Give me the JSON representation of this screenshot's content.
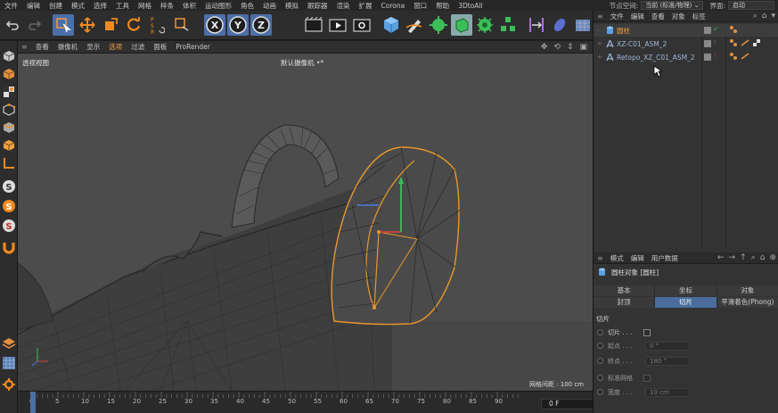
{
  "menubar": {
    "items": [
      "文件",
      "编辑",
      "创建",
      "模式",
      "选择",
      "工具",
      "网格",
      "样条",
      "体积",
      "运动图形",
      "角色",
      "动画",
      "模拟",
      "跟踪器",
      "渲染",
      "扩展",
      "Corona",
      "窗口",
      "帮助",
      "3DtoAll"
    ],
    "node_space_label": "节点空间:",
    "node_space_value": "当前 (标准/物理)",
    "layout_label": "界面:",
    "layout_value": "启动"
  },
  "toolbar": {
    "icons": [
      "undo-icon",
      "redo-icon",
      "live-select-icon",
      "move-icon",
      "scale-icon",
      "rotate-icon",
      "psr-icon",
      "select-recent-icon",
      "x-axis-icon",
      "y-axis-icon",
      "z-axis-icon",
      "render-view-icon",
      "render-picture-icon",
      "render-settings-icon",
      "cube-icon",
      "pen-icon",
      "subdivision-icon",
      "extrude-icon",
      "cloner-icon",
      "mograph-icon",
      "symmetry-icon",
      "deformer-icon",
      "floor-icon"
    ],
    "axis_labels": [
      "X",
      "Y",
      "Z"
    ]
  },
  "viewport": {
    "menu": [
      "查看",
      "摄像机",
      "显示",
      "选项",
      "过滤",
      "面板",
      "ProRender"
    ],
    "label": "透视视图",
    "camera": "默认摄像机",
    "camera_suffix": "•*",
    "grid_spacing": "网格间距 : 100 cm"
  },
  "timeline": {
    "ticks": [
      "0",
      "5",
      "10",
      "15",
      "20",
      "25",
      "30",
      "35",
      "40",
      "45",
      "50",
      "55",
      "60",
      "65",
      "70",
      "75",
      "80",
      "85",
      "90"
    ],
    "current_frame": "0 F"
  },
  "object_manager": {
    "menu": [
      "文件",
      "编辑",
      "查看",
      "对象",
      "标签"
    ],
    "objects": [
      {
        "name": "圆柱",
        "color": "#e8a030",
        "selected": true
      },
      {
        "name": "XZ-C01_ASM_2",
        "color": "#9fb6d6",
        "selected": false
      },
      {
        "name": "Retopo_XZ_C01_ASM_2",
        "color": "#9fb6d6",
        "selected": false
      }
    ]
  },
  "attributes": {
    "menu": [
      "模式",
      "编辑",
      "用户数据"
    ],
    "title": "圆柱对象 [圆柱]",
    "tabs_row1": [
      "基本",
      "坐标",
      "对象"
    ],
    "tabs_row2": [
      "封顶",
      "切片",
      "平滑着色(Phong)"
    ],
    "active_tab": "切片",
    "section": "切片",
    "params": [
      {
        "label": "切片 . . .",
        "value": ""
      },
      {
        "label": "起点 . . .",
        "value": "0 °"
      },
      {
        "label": "终点 . . .",
        "value": "180 °"
      },
      {
        "label": "标准网格",
        "value": ""
      },
      {
        "label": "宽度 . . .",
        "value": "10 cm"
      }
    ]
  },
  "colors": {
    "accent": "#4b6fa8",
    "selection_orange": "#e8962c",
    "viewport_bg": "#4c4c4c"
  }
}
